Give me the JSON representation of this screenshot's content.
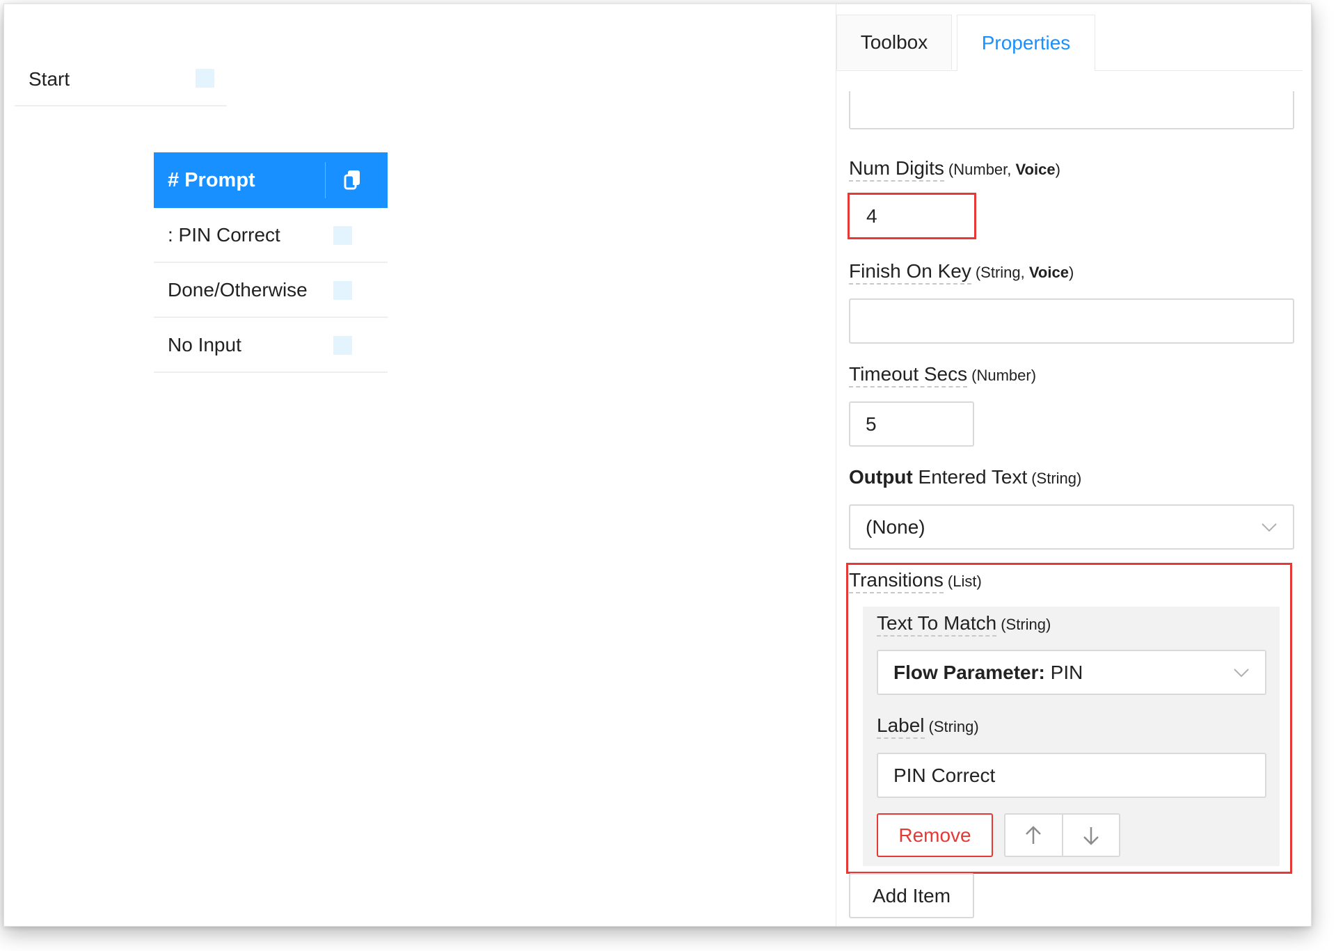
{
  "canvas": {
    "start_node": {
      "label": "Start"
    },
    "prompt_node": {
      "title": "# Prompt",
      "rows": [
        ": PIN Correct",
        "Done/Otherwise",
        "No Input"
      ]
    }
  },
  "panel": {
    "tabs": [
      {
        "label": "Toolbox",
        "active": false
      },
      {
        "label": "Properties",
        "active": true
      }
    ],
    "fields": {
      "num_digits": {
        "name": "Num Digits",
        "type_prefix": "(Number, ",
        "type_bold": "Voice",
        "type_suffix": ")",
        "value": "4"
      },
      "finish_on_key": {
        "name": "Finish On Key",
        "type_prefix": "(String, ",
        "type_bold": "Voice",
        "type_suffix": ")",
        "value": ""
      },
      "timeout_secs": {
        "name": "Timeout Secs",
        "type": "(Number)",
        "value": "5"
      },
      "output_entered_text": {
        "name_bold": "Output",
        "name": " Entered Text",
        "type": "(String)",
        "selected": "(None)"
      },
      "transitions": {
        "name": "Transitions",
        "type": "(List)",
        "item": {
          "text_to_match": {
            "name": "Text To Match",
            "type": "(String)",
            "selected_bold": "Flow Parameter:",
            "selected": " PIN"
          },
          "label": {
            "name": "Label",
            "type": "(String)",
            "value": "PIN Correct"
          },
          "remove_label": "Remove"
        },
        "add_item_label": "Add Item"
      }
    }
  },
  "colors": {
    "accent": "#1890ff",
    "highlight": "#e53935",
    "port": "#e3f4fe"
  }
}
